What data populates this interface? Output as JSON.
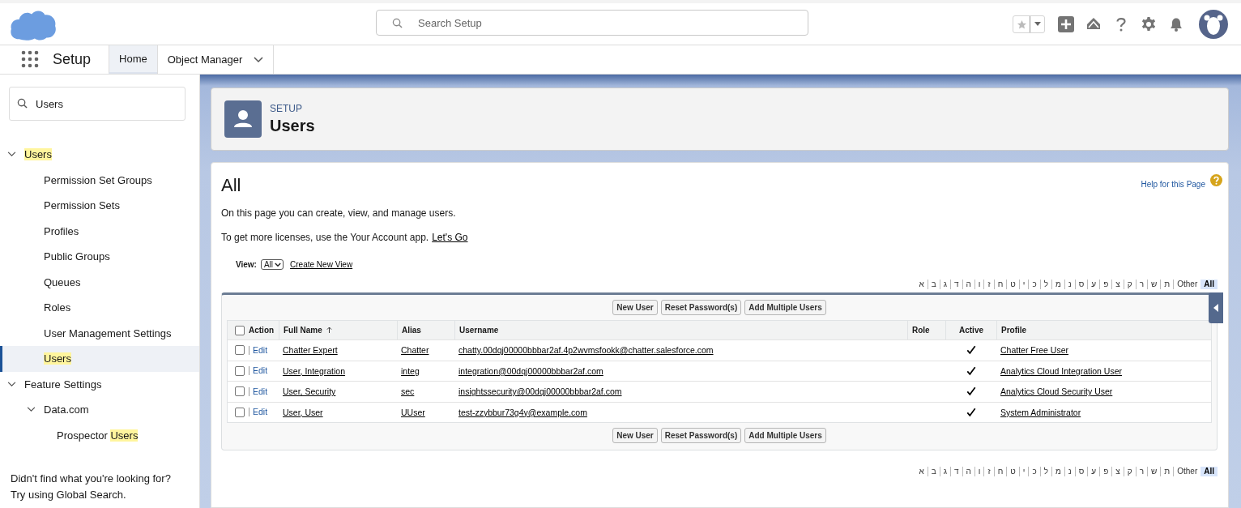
{
  "header": {
    "search_placeholder": "Search Setup"
  },
  "nav": {
    "app_name": "Setup",
    "tabs": [
      {
        "label": "Home",
        "selected": true,
        "has_menu": false
      },
      {
        "label": "Object Manager",
        "selected": false,
        "has_menu": true
      }
    ]
  },
  "sidebar": {
    "search_value": "Users",
    "tree": [
      {
        "segments": [
          {
            "text": "Users",
            "highlighted": true
          }
        ],
        "selected": false,
        "expanded": true,
        "children": [
          {
            "segments": [
              {
                "text": "Permission Set Groups",
                "highlighted": false
              }
            ],
            "selected": false
          },
          {
            "segments": [
              {
                "text": "Permission Sets",
                "highlighted": false
              }
            ],
            "selected": false
          },
          {
            "segments": [
              {
                "text": "Profiles",
                "highlighted": false
              }
            ],
            "selected": false
          },
          {
            "segments": [
              {
                "text": "Public Groups",
                "highlighted": false
              }
            ],
            "selected": false
          },
          {
            "segments": [
              {
                "text": "Queues",
                "highlighted": false
              }
            ],
            "selected": false
          },
          {
            "segments": [
              {
                "text": "Roles",
                "highlighted": false
              }
            ],
            "selected": false
          },
          {
            "segments": [
              {
                "text": "User Management Settings",
                "highlighted": false
              }
            ],
            "selected": false
          },
          {
            "segments": [
              {
                "text": "Users",
                "highlighted": true
              }
            ],
            "selected": true
          }
        ]
      },
      {
        "segments": [
          {
            "text": "Feature Settings",
            "highlighted": false
          }
        ],
        "selected": false,
        "expanded": true,
        "children": [
          {
            "segments": [
              {
                "text": "Data.com",
                "highlighted": false
              }
            ],
            "selected": false,
            "expanded": true,
            "children": [
              {
                "segments": [
                  {
                    "text": "Prospector ",
                    "highlighted": false
                  },
                  {
                    "text": "Users",
                    "highlighted": true
                  }
                ],
                "selected": false
              }
            ]
          }
        ]
      }
    ],
    "footer": [
      "Didn't find what you're looking for?",
      "Try using Global Search."
    ]
  },
  "page_header": {
    "eyebrow": "SETUP",
    "title": "Users"
  },
  "content": {
    "title": "All",
    "help_link": "Help for this Page",
    "intro": "On this page you can create, view, and manage users.",
    "licenses_text": "To get more licenses, use the Your Account app.",
    "licenses_link": "Let's Go",
    "view_label": "View:",
    "view_value": "All",
    "create_view_link": "Create New View",
    "letters_top": [
      {
        "label": "All",
        "selected": true
      },
      {
        "label": "Other",
        "selected": false
      },
      {
        "label": "ת",
        "selected": false
      },
      {
        "label": "ש",
        "selected": false
      },
      {
        "label": "ר",
        "selected": false
      },
      {
        "label": "ק",
        "selected": false
      },
      {
        "label": "צ",
        "selected": false
      },
      {
        "label": "פ",
        "selected": false
      },
      {
        "label": "ע",
        "selected": false
      },
      {
        "label": "ס",
        "selected": false
      },
      {
        "label": "נ",
        "selected": false
      },
      {
        "label": "מ",
        "selected": false
      },
      {
        "label": "ל",
        "selected": false
      },
      {
        "label": "כ",
        "selected": false
      },
      {
        "label": "י",
        "selected": false
      },
      {
        "label": "ט",
        "selected": false
      },
      {
        "label": "ח",
        "selected": false
      },
      {
        "label": "ז",
        "selected": false
      },
      {
        "label": "ו",
        "selected": false
      },
      {
        "label": "ה",
        "selected": false
      },
      {
        "label": "ד",
        "selected": false
      },
      {
        "label": "ג",
        "selected": false
      },
      {
        "label": "ב",
        "selected": false
      },
      {
        "label": "א",
        "selected": false
      }
    ],
    "buttons_top": [
      "New User",
      "Reset Password(s)",
      "Add Multiple Users"
    ],
    "table": {
      "select_all_checked": false,
      "columns": [
        {
          "label": "Action"
        },
        {
          "label": "Full Name",
          "sorted_ascending": true
        },
        {
          "label": "Alias"
        },
        {
          "label": "Username"
        },
        {
          "label": "Role"
        },
        {
          "label": "Active"
        },
        {
          "label": "Profile"
        }
      ],
      "rows": [
        {
          "checked": false,
          "action": "Edit",
          "full_name": "Chatter Expert",
          "alias": "Chatter",
          "username": "chatty.00dqj00000bbbar2af.4p2wvmsfookk@chatter.salesforce.com",
          "active": true,
          "profile": "Chatter Free User"
        },
        {
          "checked": false,
          "action": "Edit",
          "full_name": "User, Integration",
          "alias": "integ",
          "username": "integration@00dqj00000bbbar2af.com",
          "active": true,
          "profile": "Analytics Cloud Integration User"
        },
        {
          "checked": false,
          "action": "Edit",
          "full_name": "User, Security",
          "alias": "sec",
          "username": "insightssecurity@00dqj00000bbbar2af.com",
          "active": true,
          "profile": "Analytics Cloud Security User"
        },
        {
          "checked": false,
          "action": "Edit",
          "full_name": "User, User",
          "alias": "UUser",
          "username": "test-zzybbur73g4y@example.com",
          "active": true,
          "profile": "System Administrator"
        }
      ]
    },
    "buttons_bottom": [
      "New User",
      "Reset Password(s)",
      "Add Multiple Users"
    ],
    "letters_bottom": [
      {
        "label": "All",
        "selected": true
      },
      {
        "label": "Other",
        "selected": false
      },
      {
        "label": "ת",
        "selected": false
      },
      {
        "label": "ש",
        "selected": false
      },
      {
        "label": "ר",
        "selected": false
      },
      {
        "label": "ק",
        "selected": false
      },
      {
        "label": "צ",
        "selected": false
      },
      {
        "label": "פ",
        "selected": false
      },
      {
        "label": "ע",
        "selected": false
      },
      {
        "label": "ס",
        "selected": false
      },
      {
        "label": "נ",
        "selected": false
      },
      {
        "label": "מ",
        "selected": false
      },
      {
        "label": "ל",
        "selected": false
      },
      {
        "label": "כ",
        "selected": false
      },
      {
        "label": "י",
        "selected": false
      },
      {
        "label": "ט",
        "selected": false
      },
      {
        "label": "ח",
        "selected": false
      },
      {
        "label": "ז",
        "selected": false
      },
      {
        "label": "ו",
        "selected": false
      },
      {
        "label": "ה",
        "selected": false
      },
      {
        "label": "ד",
        "selected": false
      },
      {
        "label": "ג",
        "selected": false
      },
      {
        "label": "ב",
        "selected": false
      },
      {
        "label": "א",
        "selected": false
      }
    ]
  }
}
